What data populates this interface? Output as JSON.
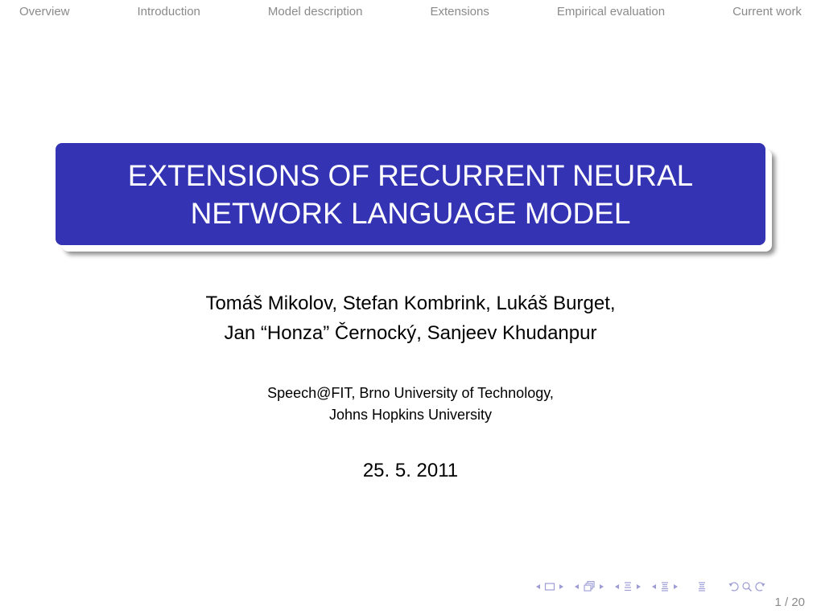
{
  "top_nav": {
    "items": [
      {
        "label": "Overview"
      },
      {
        "label": "Introduction"
      },
      {
        "label": "Model description"
      },
      {
        "label": "Extensions"
      },
      {
        "label": "Empirical evaluation"
      },
      {
        "label": "Current work"
      }
    ]
  },
  "title": {
    "line1": "EXTENSIONS OF RECURRENT NEURAL",
    "line2": "NETWORK LANGUAGE MODEL",
    "background_color": "#3333b3",
    "text_color": "#ffffff"
  },
  "authors": {
    "line1": "Tomáš Mikolov, Stefan Kombrink, Lukáš Burget,",
    "line2": "Jan “Honza” Černocký, Sanjeev Khudanpur"
  },
  "institutes": {
    "line1": "Speech@FIT, Brno University of Technology,",
    "line2": "Johns Hopkins University"
  },
  "date": "25. 5. 2011",
  "navigation_symbols": {
    "color": "#9c9cd6",
    "items": [
      "prev-arrow",
      "slide-icon",
      "next-arrow",
      "prev-arrow",
      "frame-icon",
      "next-arrow",
      "prev-arrow",
      "subsection-icon",
      "next-arrow",
      "prev-arrow",
      "section-icon",
      "next-arrow",
      "outline-icon",
      "undo-icon",
      "search-icon",
      "redo-icon"
    ]
  },
  "page": {
    "current": 1,
    "total": 20,
    "label": "1 / 20"
  }
}
